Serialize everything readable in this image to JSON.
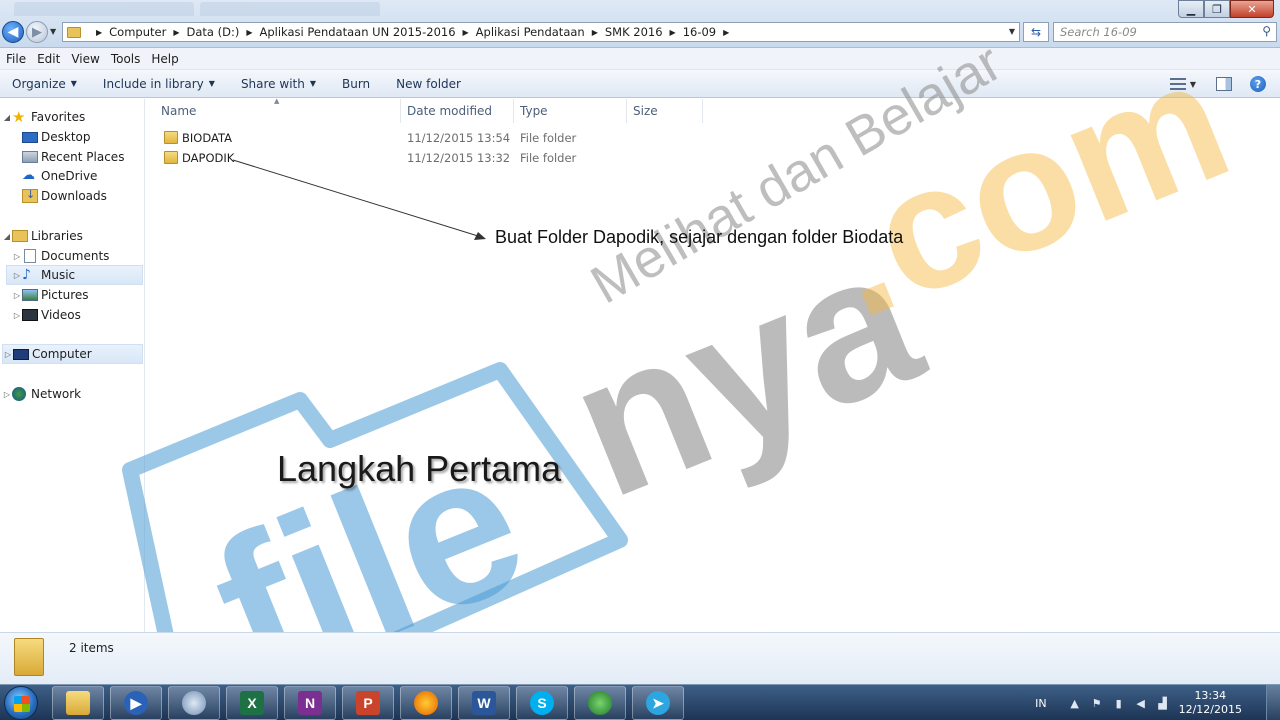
{
  "window": {
    "controls": {
      "minimize": "▁",
      "maximize": "❐",
      "close": "✕"
    }
  },
  "address_bar": {
    "crumbs": [
      "Computer",
      "Data (D:)",
      "Aplikasi Pendataan UN 2015-2016",
      "Aplikasi Pendataan",
      "SMK 2016",
      "16-09"
    ],
    "search_placeholder": "Search 16-09"
  },
  "menu": [
    "File",
    "Edit",
    "View",
    "Tools",
    "Help"
  ],
  "toolbar": {
    "organize": "Organize",
    "include_in_library": "Include in library",
    "share_with": "Share with",
    "burn": "Burn",
    "new_folder": "New folder"
  },
  "nav": {
    "favorites": "Favorites",
    "desktop": "Desktop",
    "recent_places": "Recent Places",
    "onedrive": "OneDrive",
    "downloads": "Downloads",
    "libraries": "Libraries",
    "documents": "Documents",
    "music": "Music",
    "pictures": "Pictures",
    "videos": "Videos",
    "computer": "Computer",
    "network": "Network"
  },
  "columns": {
    "name": "Name",
    "date_modified": "Date modified",
    "type": "Type",
    "size": "Size"
  },
  "files": [
    {
      "name": "BIODATA",
      "date": "11/12/2015 13:54",
      "type": "File folder"
    },
    {
      "name": "DAPODIK",
      "date": "11/12/2015 13:32",
      "type": "File folder"
    }
  ],
  "annotations": {
    "callout": "Buat Folder Dapodik, sejajar dengan folder Biodata",
    "step_title": "Langkah Pertama"
  },
  "watermark": {
    "brand_blue": "file",
    "brand_gray": "nya",
    "brand_orange": ".com",
    "tagline": "Melihat dan Belajar"
  },
  "status": {
    "item_count": "2 items"
  },
  "taskbar": {
    "apps": [
      "Windows Explorer",
      "Media Player",
      "Thunderbird",
      "Excel",
      "OneNote",
      "PowerPoint",
      "Firefox",
      "Word",
      "Skype",
      "Internet Download Manager",
      "Telegram"
    ],
    "glyphs": {
      "excel": "X",
      "onenote": "N",
      "ppt": "P",
      "word": "W",
      "skype": "S",
      "telegram": "➤",
      "media": "▶"
    },
    "lang": "IN",
    "time": "13:34",
    "date": "12/12/2015"
  },
  "colors": {
    "watermark_blue": "#4a9bd6",
    "watermark_gray": "#7a7a7a",
    "watermark_orange": "#f5b73c",
    "taskbar": "#1d3556"
  }
}
